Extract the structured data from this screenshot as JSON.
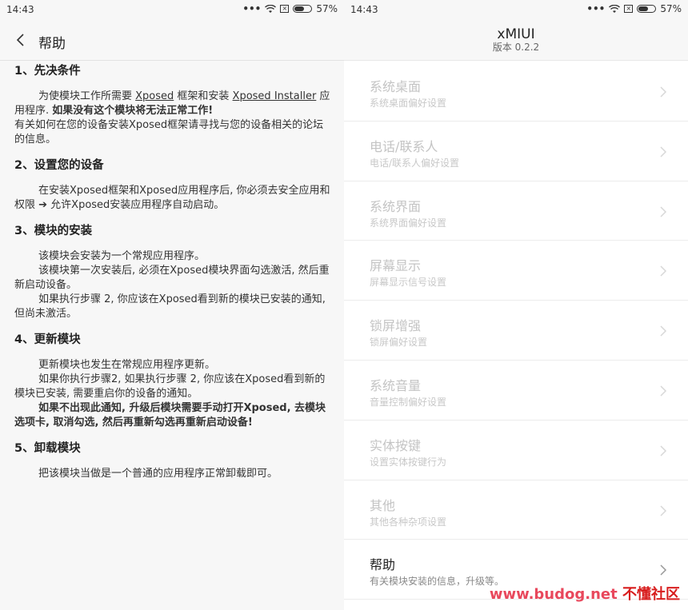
{
  "left": {
    "status": {
      "time": "14:43",
      "battery": "57%"
    },
    "header": {
      "title": "帮助"
    },
    "sections": [
      {
        "title": "1、先决条件",
        "lines": [
          {
            "indent": true,
            "parts": [
              {
                "t": "为使模块工作所需要 "
              },
              {
                "t": "Xposed",
                "u": true
              },
              {
                "t": " 框架和安装 "
              },
              {
                "t": "Xposed Installer",
                "u": true
              },
              {
                "t": " 应用程序. "
              },
              {
                "t": "如果没有这个模块将无法正常工作!",
                "b": true
              }
            ]
          },
          {
            "indent": false,
            "parts": [
              {
                "t": "有关如何在您的设备安装Xposed框架请寻找与您的设备相关的论坛的信息。"
              }
            ]
          }
        ]
      },
      {
        "title": "2、设置您的设备",
        "lines": [
          {
            "indent": true,
            "parts": [
              {
                "t": "在安装Xposed框架和Xposed应用程序后, 你必须去安全应用和权限 ➔ 允许Xposed安装应用程序自动启动。"
              }
            ]
          }
        ]
      },
      {
        "title": "3、模块的安装",
        "lines": [
          {
            "indent": true,
            "parts": [
              {
                "t": "该模块会安装为一个常规应用程序。"
              }
            ]
          },
          {
            "indent": true,
            "parts": [
              {
                "t": "该模块第一次安装后, 必须在Xposed模块界面勾选激活, 然后重新启动设备。"
              }
            ]
          },
          {
            "indent": true,
            "parts": [
              {
                "t": "如果执行步骤 2, 你应该在Xposed看到新的模块已安装的通知, 但尚未激活。"
              }
            ]
          }
        ]
      },
      {
        "title": "4、更新模块",
        "lines": [
          {
            "indent": true,
            "parts": [
              {
                "t": "更新模块也发生在常规应用程序更新。"
              }
            ]
          },
          {
            "indent": true,
            "parts": [
              {
                "t": "如果你执行步骤2, 如果执行步骤 2, 你应该在Xposed看到新的模块已安装, 需要重启你的设备的通知。"
              }
            ]
          },
          {
            "indent": true,
            "parts": [
              {
                "t": "如果不出现此通知, 升级后模块需要手动打开Xposed, 去模块选项卡, 取消勾选, 然后再重新勾选再重新启动设备!",
                "b": true
              }
            ]
          }
        ]
      },
      {
        "title": "5、卸载模块",
        "lines": [
          {
            "indent": true,
            "parts": [
              {
                "t": "把该模块当做是一个普通的应用程序正常卸载即可。"
              }
            ]
          }
        ]
      }
    ]
  },
  "right": {
    "status": {
      "time": "14:43",
      "battery": "57%"
    },
    "header": {
      "title": "xMIUI",
      "version": "版本 0.2.2"
    },
    "items": [
      {
        "title": "系统桌面",
        "subtitle": "系统桌面偏好设置",
        "active": false
      },
      {
        "title": "电话/联系人",
        "subtitle": "电话/联系人偏好设置",
        "active": false
      },
      {
        "title": "系统界面",
        "subtitle": "系统界面偏好设置",
        "active": false
      },
      {
        "title": "屏幕显示",
        "subtitle": "屏幕显示信号设置",
        "active": false
      },
      {
        "title": "锁屏增强",
        "subtitle": "锁屏偏好设置",
        "active": false
      },
      {
        "title": "系统音量",
        "subtitle": "音量控制偏好设置",
        "active": false
      },
      {
        "title": "实体按键",
        "subtitle": "设置实体按键行为",
        "active": false
      },
      {
        "title": "其他",
        "subtitle": "其他各种杂项设置",
        "active": false
      },
      {
        "title": "帮助",
        "subtitle": "有关模块安装的信息，升级等。",
        "active": true
      }
    ]
  },
  "watermark": {
    "url": "www.budog.net",
    "cn": "不懂社区"
  }
}
